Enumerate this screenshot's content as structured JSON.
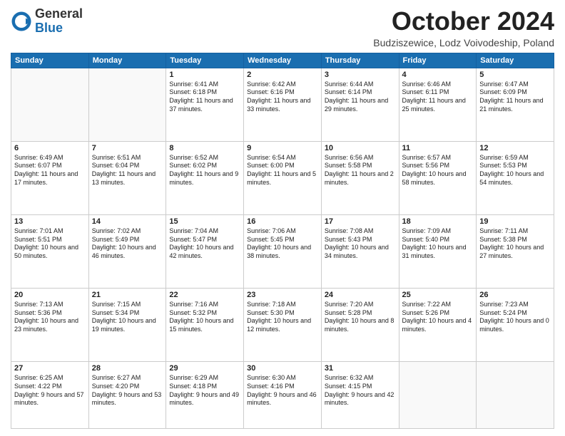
{
  "header": {
    "logo_general": "General",
    "logo_blue": "Blue",
    "month_title": "October 2024",
    "subtitle": "Budziszewice, Lodz Voivodeship, Poland"
  },
  "days_of_week": [
    "Sunday",
    "Monday",
    "Tuesday",
    "Wednesday",
    "Thursday",
    "Friday",
    "Saturday"
  ],
  "weeks": [
    [
      {
        "day": "",
        "info": ""
      },
      {
        "day": "",
        "info": ""
      },
      {
        "day": "1",
        "info": "Sunrise: 6:41 AM\nSunset: 6:18 PM\nDaylight: 11 hours and 37 minutes."
      },
      {
        "day": "2",
        "info": "Sunrise: 6:42 AM\nSunset: 6:16 PM\nDaylight: 11 hours and 33 minutes."
      },
      {
        "day": "3",
        "info": "Sunrise: 6:44 AM\nSunset: 6:14 PM\nDaylight: 11 hours and 29 minutes."
      },
      {
        "day": "4",
        "info": "Sunrise: 6:46 AM\nSunset: 6:11 PM\nDaylight: 11 hours and 25 minutes."
      },
      {
        "day": "5",
        "info": "Sunrise: 6:47 AM\nSunset: 6:09 PM\nDaylight: 11 hours and 21 minutes."
      }
    ],
    [
      {
        "day": "6",
        "info": "Sunrise: 6:49 AM\nSunset: 6:07 PM\nDaylight: 11 hours and 17 minutes."
      },
      {
        "day": "7",
        "info": "Sunrise: 6:51 AM\nSunset: 6:04 PM\nDaylight: 11 hours and 13 minutes."
      },
      {
        "day": "8",
        "info": "Sunrise: 6:52 AM\nSunset: 6:02 PM\nDaylight: 11 hours and 9 minutes."
      },
      {
        "day": "9",
        "info": "Sunrise: 6:54 AM\nSunset: 6:00 PM\nDaylight: 11 hours and 5 minutes."
      },
      {
        "day": "10",
        "info": "Sunrise: 6:56 AM\nSunset: 5:58 PM\nDaylight: 11 hours and 2 minutes."
      },
      {
        "day": "11",
        "info": "Sunrise: 6:57 AM\nSunset: 5:56 PM\nDaylight: 10 hours and 58 minutes."
      },
      {
        "day": "12",
        "info": "Sunrise: 6:59 AM\nSunset: 5:53 PM\nDaylight: 10 hours and 54 minutes."
      }
    ],
    [
      {
        "day": "13",
        "info": "Sunrise: 7:01 AM\nSunset: 5:51 PM\nDaylight: 10 hours and 50 minutes."
      },
      {
        "day": "14",
        "info": "Sunrise: 7:02 AM\nSunset: 5:49 PM\nDaylight: 10 hours and 46 minutes."
      },
      {
        "day": "15",
        "info": "Sunrise: 7:04 AM\nSunset: 5:47 PM\nDaylight: 10 hours and 42 minutes."
      },
      {
        "day": "16",
        "info": "Sunrise: 7:06 AM\nSunset: 5:45 PM\nDaylight: 10 hours and 38 minutes."
      },
      {
        "day": "17",
        "info": "Sunrise: 7:08 AM\nSunset: 5:43 PM\nDaylight: 10 hours and 34 minutes."
      },
      {
        "day": "18",
        "info": "Sunrise: 7:09 AM\nSunset: 5:40 PM\nDaylight: 10 hours and 31 minutes."
      },
      {
        "day": "19",
        "info": "Sunrise: 7:11 AM\nSunset: 5:38 PM\nDaylight: 10 hours and 27 minutes."
      }
    ],
    [
      {
        "day": "20",
        "info": "Sunrise: 7:13 AM\nSunset: 5:36 PM\nDaylight: 10 hours and 23 minutes."
      },
      {
        "day": "21",
        "info": "Sunrise: 7:15 AM\nSunset: 5:34 PM\nDaylight: 10 hours and 19 minutes."
      },
      {
        "day": "22",
        "info": "Sunrise: 7:16 AM\nSunset: 5:32 PM\nDaylight: 10 hours and 15 minutes."
      },
      {
        "day": "23",
        "info": "Sunrise: 7:18 AM\nSunset: 5:30 PM\nDaylight: 10 hours and 12 minutes."
      },
      {
        "day": "24",
        "info": "Sunrise: 7:20 AM\nSunset: 5:28 PM\nDaylight: 10 hours and 8 minutes."
      },
      {
        "day": "25",
        "info": "Sunrise: 7:22 AM\nSunset: 5:26 PM\nDaylight: 10 hours and 4 minutes."
      },
      {
        "day": "26",
        "info": "Sunrise: 7:23 AM\nSunset: 5:24 PM\nDaylight: 10 hours and 0 minutes."
      }
    ],
    [
      {
        "day": "27",
        "info": "Sunrise: 6:25 AM\nSunset: 4:22 PM\nDaylight: 9 hours and 57 minutes."
      },
      {
        "day": "28",
        "info": "Sunrise: 6:27 AM\nSunset: 4:20 PM\nDaylight: 9 hours and 53 minutes."
      },
      {
        "day": "29",
        "info": "Sunrise: 6:29 AM\nSunset: 4:18 PM\nDaylight: 9 hours and 49 minutes."
      },
      {
        "day": "30",
        "info": "Sunrise: 6:30 AM\nSunset: 4:16 PM\nDaylight: 9 hours and 46 minutes."
      },
      {
        "day": "31",
        "info": "Sunrise: 6:32 AM\nSunset: 4:15 PM\nDaylight: 9 hours and 42 minutes."
      },
      {
        "day": "",
        "info": ""
      },
      {
        "day": "",
        "info": ""
      }
    ]
  ]
}
